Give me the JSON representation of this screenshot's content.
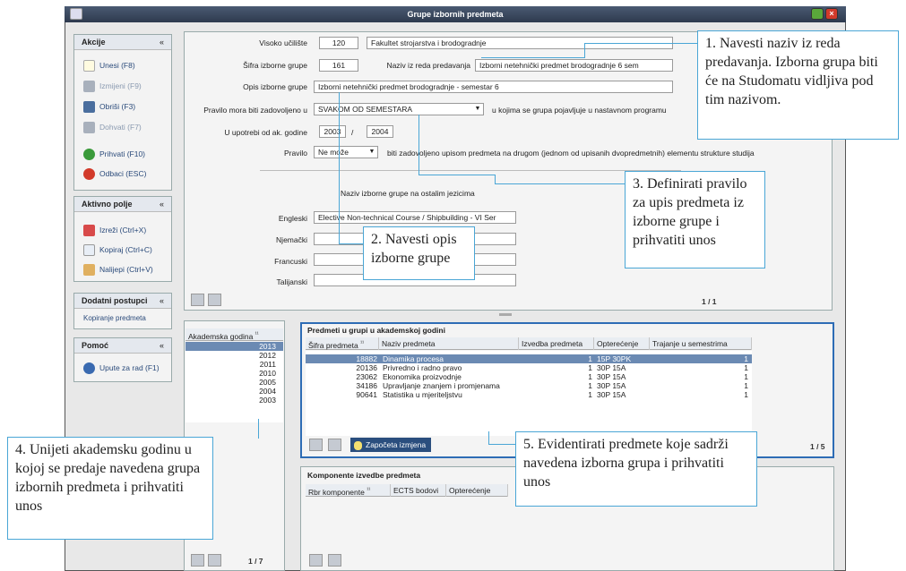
{
  "window": {
    "title": "Grupe izbornih predmeta"
  },
  "sidebar": {
    "actions": {
      "title": "Akcije",
      "chev": "«",
      "items": [
        {
          "label": "Unesi (F8)"
        },
        {
          "label": "Izmijeni (F9)"
        },
        {
          "label": "Obriši (F3)"
        },
        {
          "label": "Dohvati (F7)"
        },
        {
          "label": "Prihvati (F10)"
        },
        {
          "label": "Odbaci (ESC)"
        }
      ]
    },
    "active_field": {
      "title": "Aktivno polje",
      "chev": "«",
      "items": [
        {
          "label": "Izreži (Ctrl+X)"
        },
        {
          "label": "Kopiraj (Ctrl+C)"
        },
        {
          "label": "Nalijepi (Ctrl+V)"
        }
      ]
    },
    "extra": {
      "title": "Dodatni postupci",
      "chev": "«",
      "items": [
        {
          "label": "Kopiranje predmeta"
        }
      ]
    },
    "help": {
      "title": "Pomoć",
      "chev": "«",
      "items": [
        {
          "label": "Upute za rad (F1)"
        }
      ]
    }
  },
  "form": {
    "visoko_uciliste": {
      "label": "Visoko učilište",
      "code": "120",
      "name": "Fakultet strojarstva i brodogradnje"
    },
    "sifra": {
      "label": "Šifra izborne grupe",
      "value": "161"
    },
    "naziv_iz_reda": {
      "label": "Naziv iz reda predavanja",
      "value": "Izborni netehnički predmet brodogradnje 6 sem"
    },
    "opis": {
      "label": "Opis izborne grupe",
      "value": "Izborni netehnički predmet brodogradnje - semestar 6"
    },
    "pravilo_zadovoljeno": {
      "label": "Pravilo mora biti zadovoljeno u",
      "value": "SVAKOM OD SEMESTARA",
      "suffix": "u kojima se grupa pojavljuje u nastavnom programu"
    },
    "u_upotrebi": {
      "label": "U upotrebi od ak. godine",
      "from": "2003",
      "sep": "/",
      "to": "2004"
    },
    "pravilo": {
      "label": "Pravilo",
      "value": "Ne može",
      "suffix": "biti zadovoljeno upisom predmeta na drugom (jednom od upisanih dvopredmetnih) elementu strukture studija"
    },
    "other_lang_title": "Naziv izborne grupe na ostalim jezicima",
    "languages": [
      {
        "label": "Engleski",
        "value": "Elective Non-technical Course / Shipbuilding - VI Ser"
      },
      {
        "label": "Njemački",
        "value": ""
      },
      {
        "label": "Francuski",
        "value": ""
      },
      {
        "label": "Talijanski",
        "value": ""
      }
    ],
    "pager": "1 / 1"
  },
  "years": {
    "header": "Akademska godina",
    "sort_mark": "¹¹",
    "items": [
      "2013",
      "2012",
      "2011",
      "2010",
      "2005",
      "2004",
      "2003"
    ],
    "selected": "2013",
    "pager": "1 / 7"
  },
  "subjects": {
    "title": "Predmeti u grupi u akademskoj godini",
    "columns": [
      "Šifra predmeta",
      "Naziv predmeta",
      "Izvedba predmeta",
      "Opterećenje",
      "Trajanje u semestrima"
    ],
    "sort_mark": "¹¹",
    "rows": [
      {
        "code": "18882",
        "name": "Dinamika procesa",
        "izvedba": "1",
        "opt": "15P 30PK",
        "traj": "1"
      },
      {
        "code": "20136",
        "name": "Privredno i radno pravo",
        "izvedba": "1",
        "opt": "30P 15A",
        "traj": "1"
      },
      {
        "code": "23062",
        "name": "Ekonomika proizvodnje",
        "izvedba": "1",
        "opt": "30P 15A",
        "traj": "1"
      },
      {
        "code": "34186",
        "name": "Upravljanje znanjem i promjenama",
        "izvedba": "1",
        "opt": "30P 15A",
        "traj": "1"
      },
      {
        "code": "90641",
        "name": "Statistika u mjeriteljstvu",
        "izvedba": "1",
        "opt": "30P 15A",
        "traj": "1"
      }
    ],
    "status_label": "Započeta izmjena",
    "pager": "1 / 5"
  },
  "components": {
    "title": "Komponente izvedbe predmeta",
    "columns": [
      "Rbr komponente",
      "ECTS bodovi",
      "Opterećenje"
    ],
    "sort_mark": "¹¹"
  },
  "callouts": {
    "c1": "1. Navesti naziv iz reda predavanja. Izborna grupa biti će na Studomatu vidljiva pod tim nazivom.",
    "c2": "2. Navesti opis izborne grupe",
    "c3": "3. Definirati pravilo za upis predmeta iz izborne grupe i prihvatiti unos",
    "c4": "4. Unijeti akademsku godinu u kojoj se predaje navedena grupa izbornih predmeta i prihvatiti unos",
    "c5": "5. Evidentirati predmete koje sadrži navedena izborna grupa i prihvatiti unos"
  },
  "colors": {
    "accent": "#4aa6d6",
    "titlebar": "#34425a",
    "selection": "#6b8ab3",
    "close": "#d23a2a",
    "maximize": "#5aa83a"
  }
}
